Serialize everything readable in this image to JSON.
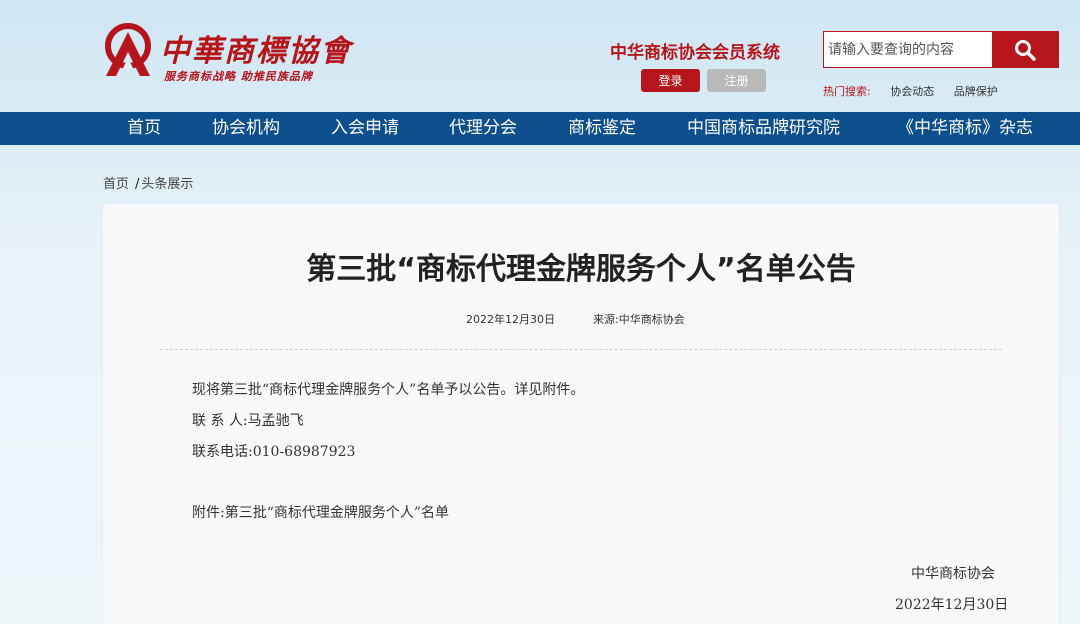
{
  "header": {
    "logo_title": "中華商標協會",
    "logo_slogan": "服务商标战略 助推民族品牌",
    "member_system_title": "中华商标协会会员系统",
    "login_label": "登录",
    "register_label": "注册",
    "search_placeholder": "请输入要查询的内容",
    "hot_search_label": "热门搜索:",
    "hot_links": [
      "协会动态",
      "品牌保护"
    ],
    "brand_color": "#b5151b"
  },
  "nav": {
    "color": "#0d4f8c",
    "items": [
      "首页",
      "协会机构",
      "入会申请",
      "代理分会",
      "商标鉴定",
      "中国商标品牌研究院",
      "《中华商标》杂志"
    ]
  },
  "breadcrumb": {
    "home": "首页",
    "separator": "/",
    "current": "头条展示"
  },
  "article": {
    "title": "第三批“商标代理金牌服务个人”名单公告",
    "date": "2022年12月30日",
    "source": "来源:中华商标协会",
    "paragraphs": [
      "现将第三批“商标代理金牌服务个人”名单予以公告。详见附件。",
      "联 系 人:马孟驰飞",
      "联系电话:010-68987923",
      "附件:第三批“商标代理金牌服务个人”名单"
    ],
    "signature_org": "中华商标协会",
    "signature_date": "2022年12月30日"
  }
}
